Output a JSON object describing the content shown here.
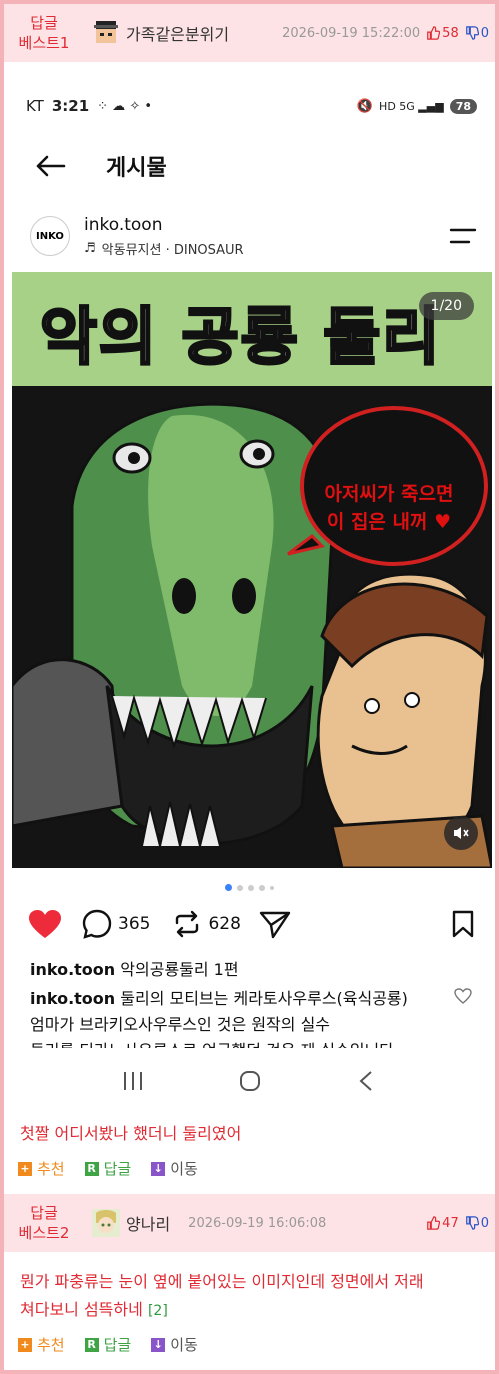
{
  "replies": [
    {
      "best_label_1": "답글",
      "best_label_2": "베스트1",
      "nickname": "가족같은분위기",
      "date": "2026-09-19 15:22:00",
      "upvotes": "58",
      "downvotes": "0",
      "comment": "첫짤 어디서봤나 했더니 둘리였어",
      "ref": ""
    },
    {
      "best_label_1": "답글",
      "best_label_2": "베스트2",
      "nickname": "양나리",
      "date": "2026-09-19 16:06:08",
      "upvotes": "47",
      "downvotes": "0",
      "comment_line1": "뭔가 파충류는 눈이 옆에 붙어있는 이미지인데 정면에서 저래",
      "comment_line2": "쳐다보니 섬뜩하네",
      "ref": "[2]"
    }
  ],
  "commands": {
    "recommend": "추천",
    "reply": "답글",
    "move": "이동"
  },
  "screenshot": {
    "status": {
      "carrier": "KT",
      "time": "3:21",
      "battery": "78"
    },
    "appbar_title": "게시물",
    "post": {
      "handle": "inko.toon",
      "music": "악동뮤지션 · DINOSAUR",
      "profile_text": "INKO",
      "image_title": "악의 공룡 둘리",
      "speech_line1": "아저씨가 죽으면",
      "speech_line2": "이 집은 내꺼 ♥",
      "counter": "1/20",
      "comments_count": "365",
      "reposts_count": "628",
      "caption1_user": "inko.toon",
      "caption1_text": "악의공룡둘리 1편",
      "caption2_user": "inko.toon",
      "caption2_text": "둘리의 모티브는 케라토사우루스(육식공룡)",
      "caption2_line2": "엄마가 브라키오사우루스인 것은 원작의 실수",
      "caption2_line3": "둘리를 티라노사우루스로 언급했던 것은 제 실수입니다"
    }
  },
  "colors": {
    "accent_red": "#e02b34",
    "frame_pink": "#f4b3b9",
    "header_pink": "#fde3e5",
    "down_blue": "#2a55c8"
  }
}
